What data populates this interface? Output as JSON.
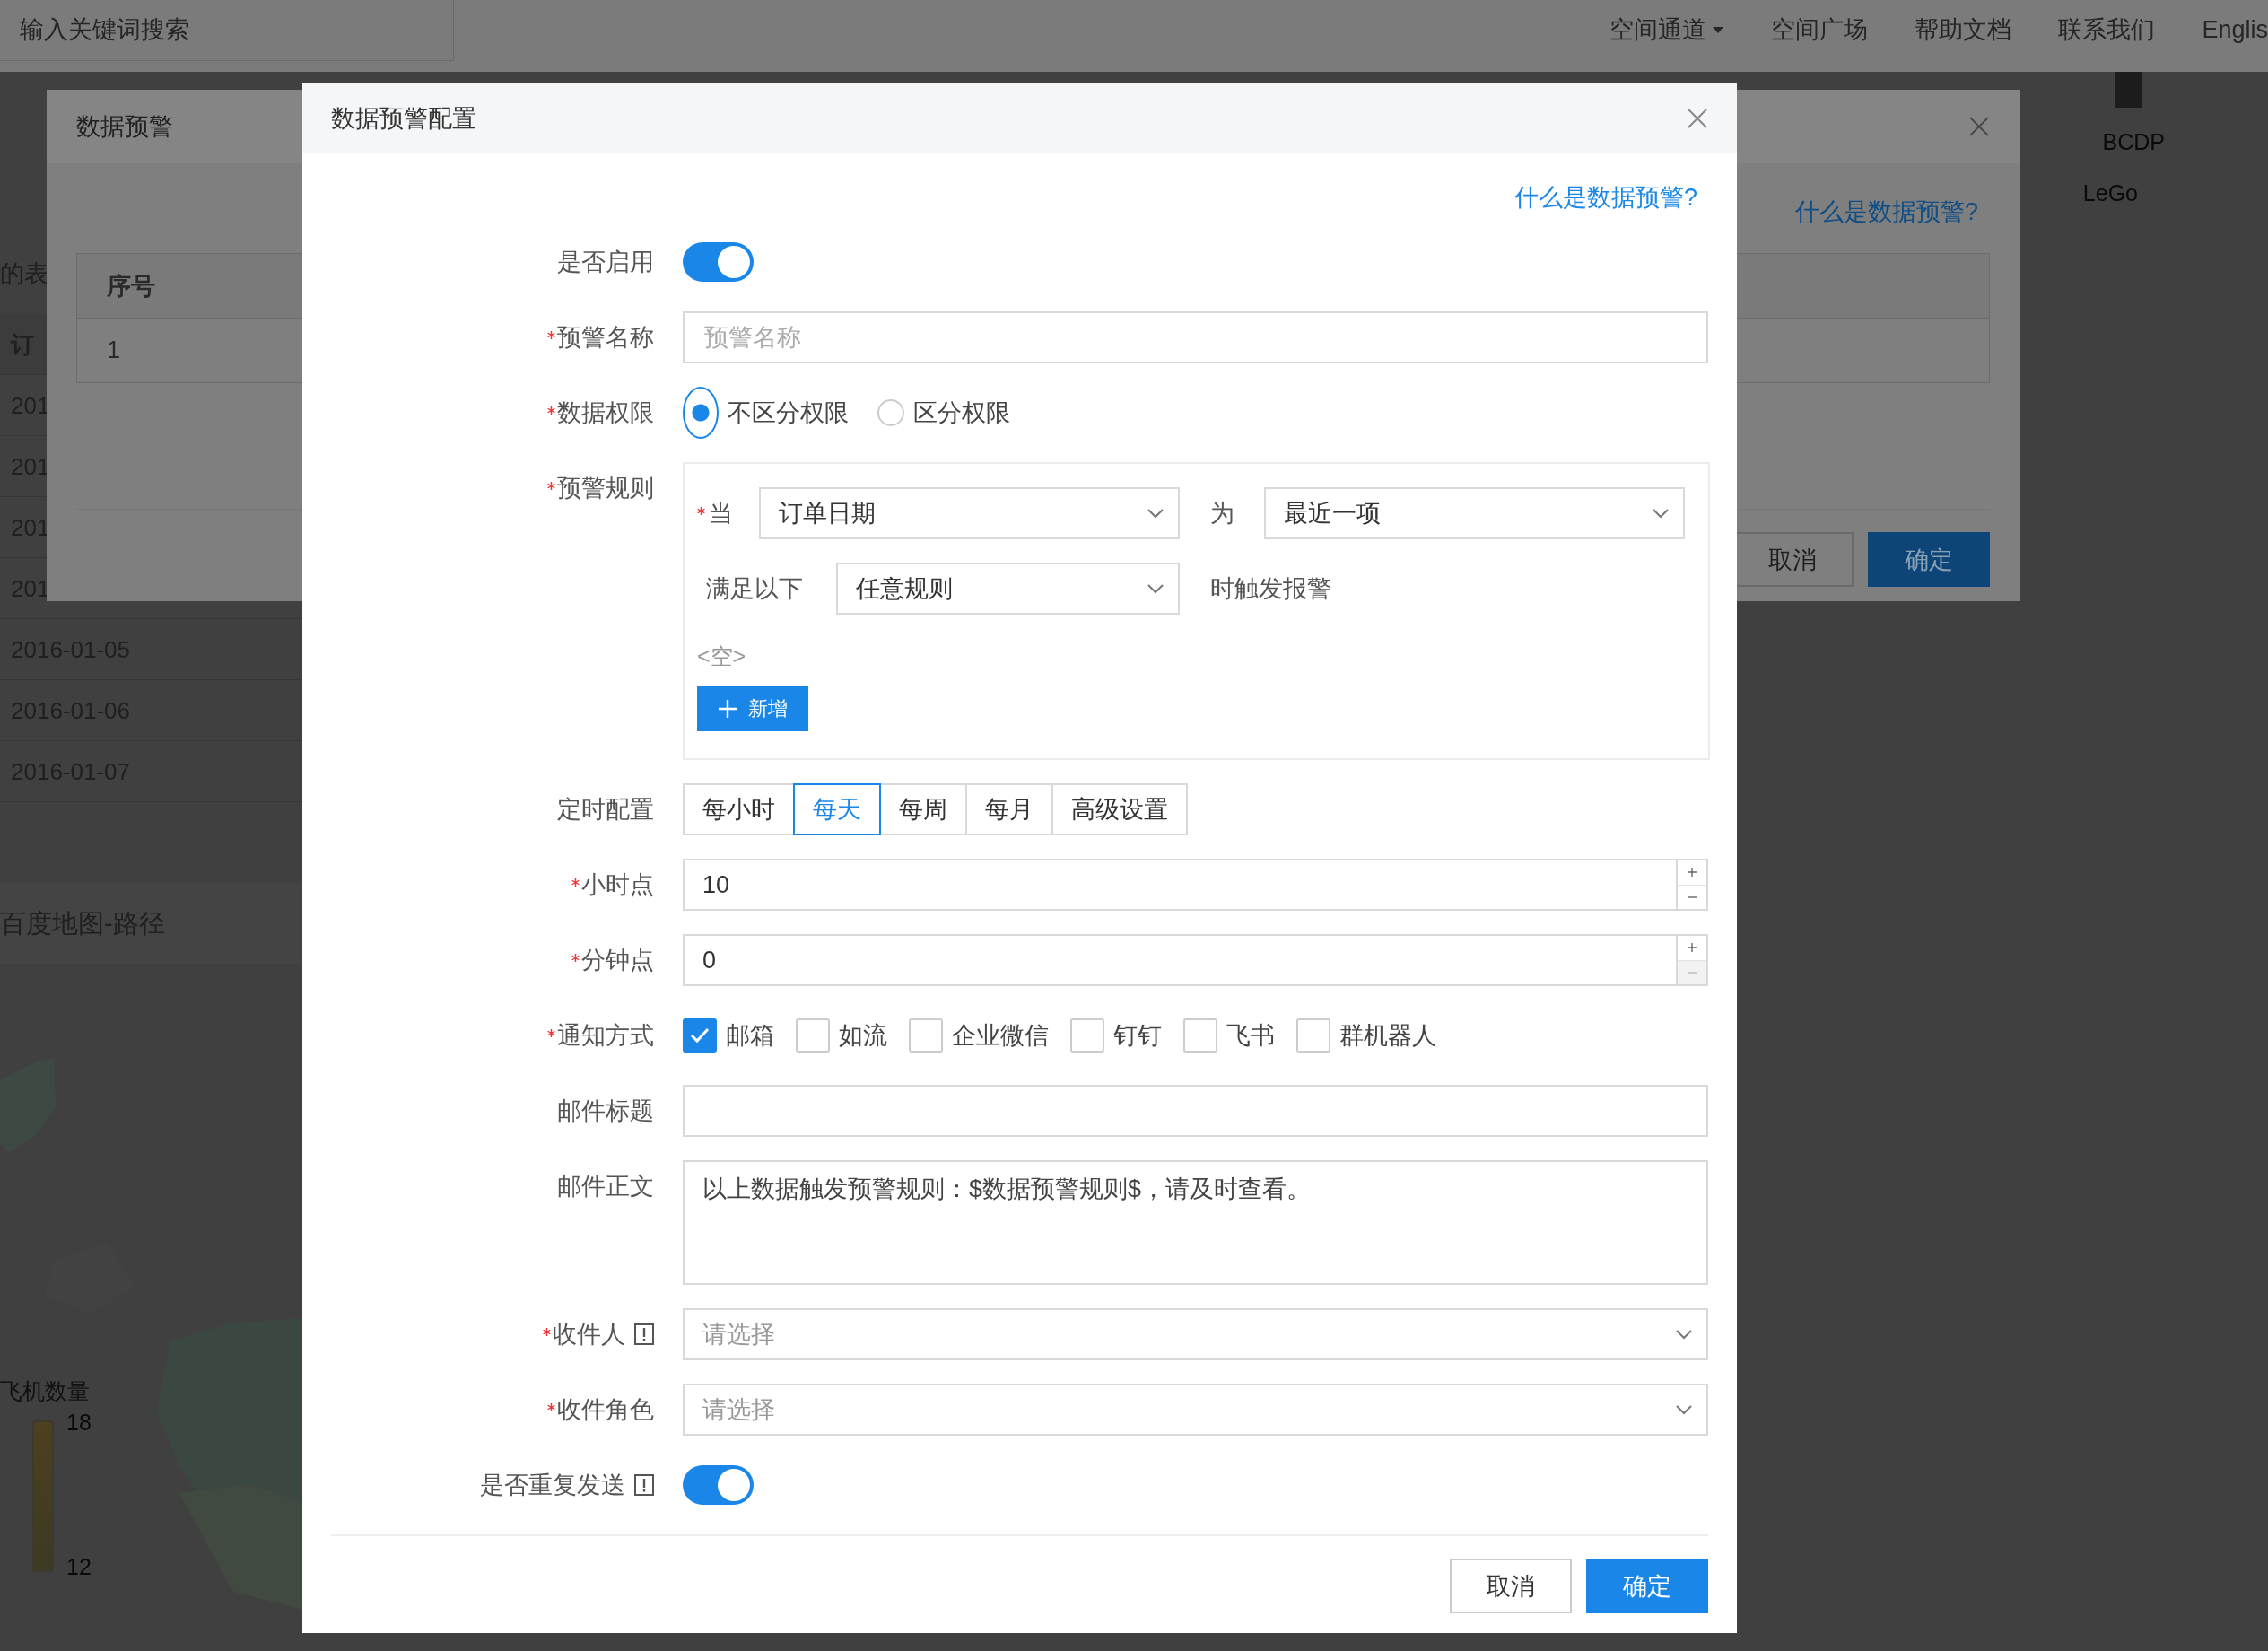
{
  "top_bar": {
    "search": {
      "placeholder": "输入关键词搜索"
    },
    "nav": [
      {
        "label": "空间通道",
        "has_menu": true
      },
      {
        "label": "空间广场",
        "has_menu": false
      },
      {
        "label": "帮助文档",
        "has_menu": false
      },
      {
        "label": "联系我们",
        "has_menu": false
      },
      {
        "label": "Englis",
        "has_menu": false
      }
    ]
  },
  "background": {
    "table_title": "的表",
    "column_header": "订",
    "rows": [
      "201",
      "201",
      "201",
      "201",
      "2016-01-05",
      "2016-01-06",
      "2016-01-07"
    ],
    "map_title": "百度地图-路径",
    "legend": {
      "title": "飞机数量",
      "max": "18",
      "min": "12"
    },
    "chart_labels": [
      "BCDP",
      "LeGo"
    ]
  },
  "back_dialog": {
    "title": "数据预警",
    "help_link": "什么是数据预警?",
    "table": {
      "columns": [
        "序号"
      ],
      "rows": [
        [
          "1"
        ]
      ]
    },
    "buttons": [
      {
        "label": "取消",
        "kind": "secondary"
      },
      {
        "label": "确定",
        "kind": "primary"
      }
    ]
  },
  "dialog": {
    "title": "数据预警配置",
    "help_link": "什么是数据预警?",
    "fields": [
      {
        "kind": "toggle",
        "label": "是否启用",
        "required": false,
        "on": true
      },
      {
        "kind": "text",
        "label": "预警名称",
        "required": true,
        "placeholder": "预警名称"
      },
      {
        "kind": "radio",
        "label": "数据权限",
        "required": true,
        "options": [
          {
            "label": "不区分权限",
            "selected": true
          },
          {
            "label": "区分权限",
            "selected": false
          }
        ]
      },
      {
        "kind": "rules",
        "label": "预警规则",
        "required": true,
        "when": {
          "label": "当",
          "required": true,
          "value": "订单日期"
        },
        "is": {
          "label": "为",
          "value": "最近一项"
        },
        "match": {
          "label": "满足以下",
          "value": "任意规则",
          "suffix": "时触发报警"
        },
        "empty_text": "<空>",
        "add_button": "新增"
      },
      {
        "kind": "segmented",
        "label": "定时配置",
        "required": false,
        "options": [
          {
            "label": "每小时",
            "selected": false
          },
          {
            "label": "每天",
            "selected": true
          },
          {
            "label": "每周",
            "selected": false
          },
          {
            "label": "每月",
            "selected": false
          },
          {
            "label": "高级设置",
            "selected": false
          }
        ]
      },
      {
        "kind": "number",
        "label": "小时点",
        "required": true,
        "value": "10",
        "minus_disabled": false
      },
      {
        "kind": "number",
        "label": "分钟点",
        "required": true,
        "value": "0",
        "minus_disabled": true
      },
      {
        "kind": "checkboxes",
        "label": "通知方式",
        "required": true,
        "options": [
          {
            "label": "邮箱",
            "checked": true
          },
          {
            "label": "如流",
            "checked": false
          },
          {
            "label": "企业微信",
            "checked": false
          },
          {
            "label": "钉钉",
            "checked": false
          },
          {
            "label": "飞书",
            "checked": false
          },
          {
            "label": "群机器人",
            "checked": false
          }
        ]
      },
      {
        "kind": "text",
        "label": "邮件标题",
        "required": false
      },
      {
        "kind": "textarea",
        "label": "邮件正文",
        "required": false,
        "value": "以上数据触发预警规则：$数据预警规则$，请及时查看。"
      },
      {
        "kind": "select",
        "label": "收件人",
        "required": true,
        "info": true,
        "placeholder": "请选择"
      },
      {
        "kind": "select",
        "label": "收件角色",
        "required": true,
        "placeholder": "请选择"
      },
      {
        "kind": "toggle",
        "label": "是否重复发送",
        "required": false,
        "info": true,
        "on": true
      }
    ],
    "buttons": [
      {
        "label": "取消",
        "kind": "secondary"
      },
      {
        "label": "确定",
        "kind": "primary"
      }
    ]
  }
}
